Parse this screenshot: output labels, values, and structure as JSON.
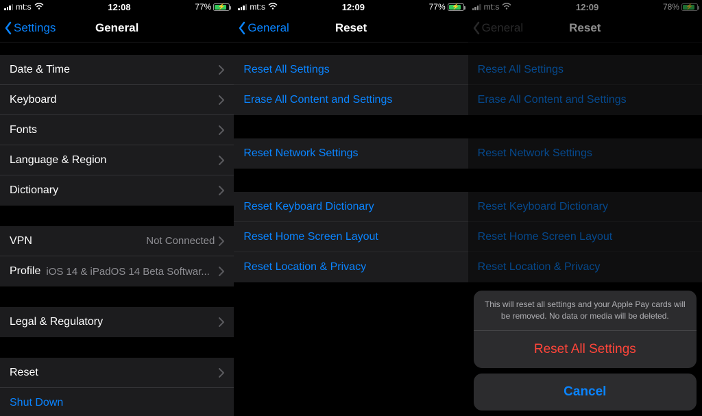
{
  "screens": [
    {
      "status": {
        "carrier": "mt:s",
        "time": "12:08",
        "battery_pct": "77%",
        "battery_fill": 77
      },
      "nav": {
        "back": "Settings",
        "title": "General"
      },
      "groups": [
        [
          {
            "label": "Date & Time"
          },
          {
            "label": "Keyboard"
          },
          {
            "label": "Fonts"
          },
          {
            "label": "Language & Region"
          },
          {
            "label": "Dictionary"
          }
        ],
        [
          {
            "label": "VPN",
            "detail": "Not Connected"
          },
          {
            "label": "Profile",
            "detail": "iOS 14 & iPadOS 14 Beta Softwar..."
          }
        ],
        [
          {
            "label": "Legal & Regulatory"
          }
        ],
        [
          {
            "label": "Reset"
          },
          {
            "label": "Shut Down",
            "link": true,
            "no_chevron": true
          }
        ]
      ]
    },
    {
      "status": {
        "carrier": "mt:s",
        "time": "12:09",
        "battery_pct": "77%",
        "battery_fill": 77
      },
      "nav": {
        "back": "General",
        "title": "Reset"
      },
      "reset_groups": [
        [
          "Reset All Settings",
          "Erase All Content and Settings"
        ],
        [
          "Reset Network Settings"
        ],
        [
          "Reset Keyboard Dictionary",
          "Reset Home Screen Layout",
          "Reset Location & Privacy"
        ]
      ]
    },
    {
      "status": {
        "carrier": "mt:s",
        "time": "12:09",
        "battery_pct": "78%",
        "battery_fill": 78
      },
      "nav": {
        "back": "General",
        "title": "Reset",
        "dim": true
      },
      "reset_groups": [
        [
          "Reset All Settings",
          "Erase All Content and Settings"
        ],
        [
          "Reset Network Settings"
        ],
        [
          "Reset Keyboard Dictionary",
          "Reset Home Screen Layout",
          "Reset Location & Privacy"
        ]
      ],
      "sheet": {
        "message": "This will reset all settings and your Apple Pay cards will be removed. No data or media will be deleted.",
        "destructive": "Reset All Settings",
        "cancel": "Cancel"
      }
    }
  ]
}
